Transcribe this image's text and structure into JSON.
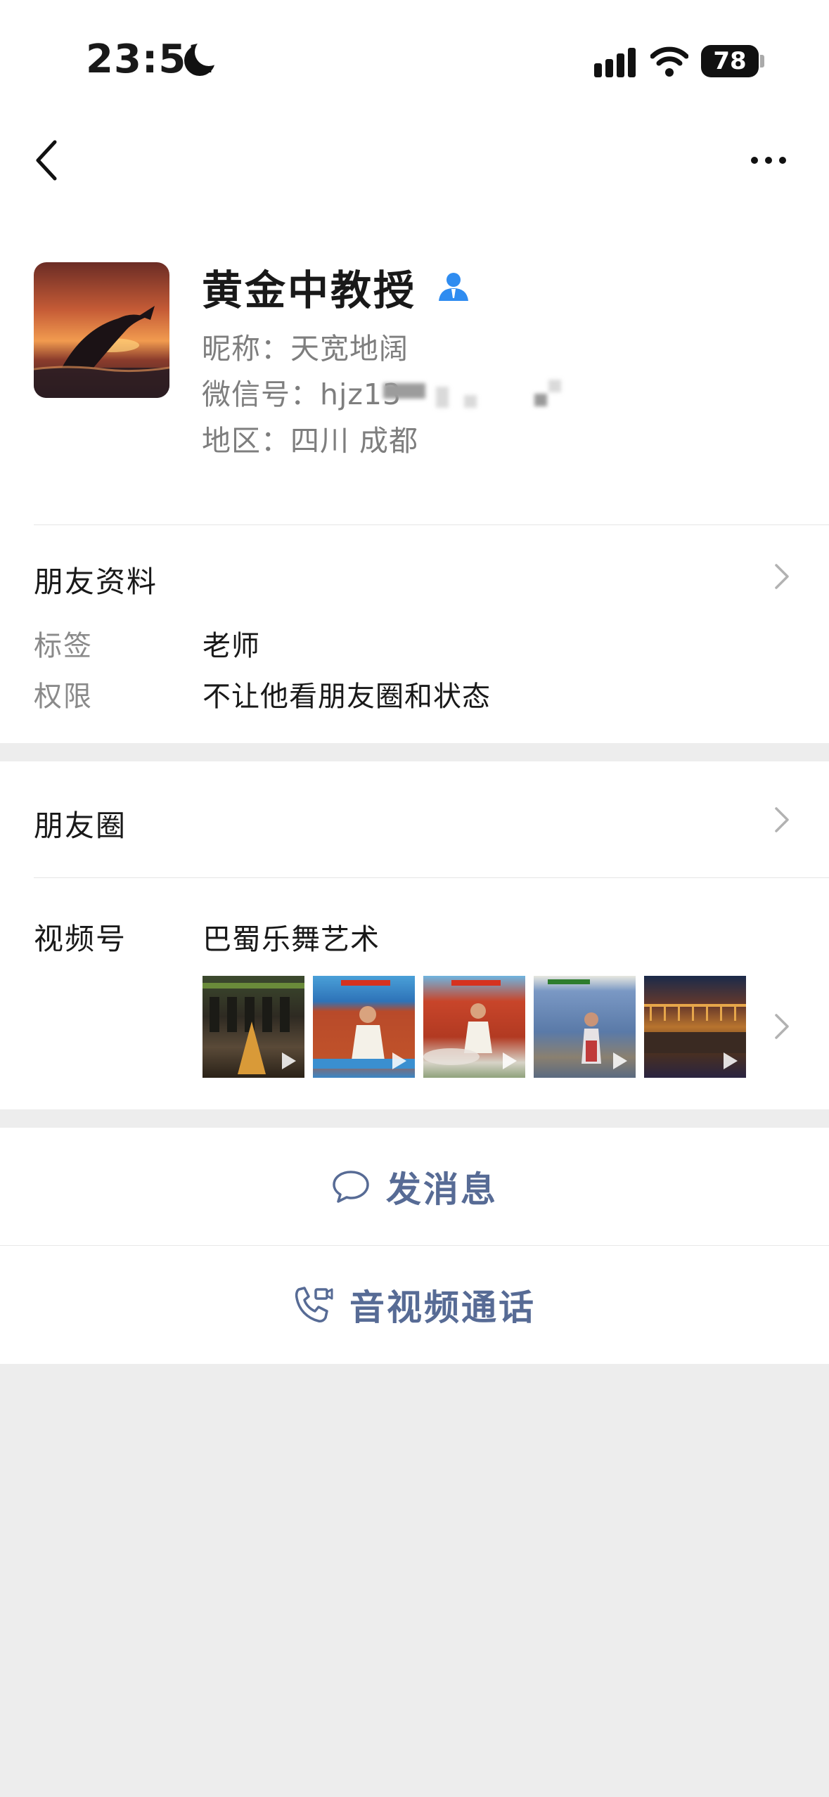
{
  "status_bar": {
    "time": "23:51",
    "battery": "78"
  },
  "profile": {
    "name": "黄金中教授",
    "nickname": "昵称：天宽地阔",
    "wechat_id": "微信号：hjz13",
    "region": "地区：四川 成都"
  },
  "friend_info": {
    "title": "朋友资料",
    "tag_label": "标签",
    "tag_value": "老师",
    "perm_label": "权限",
    "perm_value": "不让他看朋友圈和状态"
  },
  "moments": {
    "title": "朋友圈"
  },
  "channels": {
    "label": "视频号",
    "name": "巴蜀乐舞艺术",
    "thumbnails": [
      "wine-display",
      "singer-white-suit-blue",
      "singer-white-suit-red",
      "singer-on-stage-blue",
      "orchestra-concert"
    ]
  },
  "actions": {
    "message": "发消息",
    "call": "音视频通话"
  },
  "colors": {
    "link": "#576b95",
    "background": "#ededed",
    "verify": "#2f8cf0"
  }
}
